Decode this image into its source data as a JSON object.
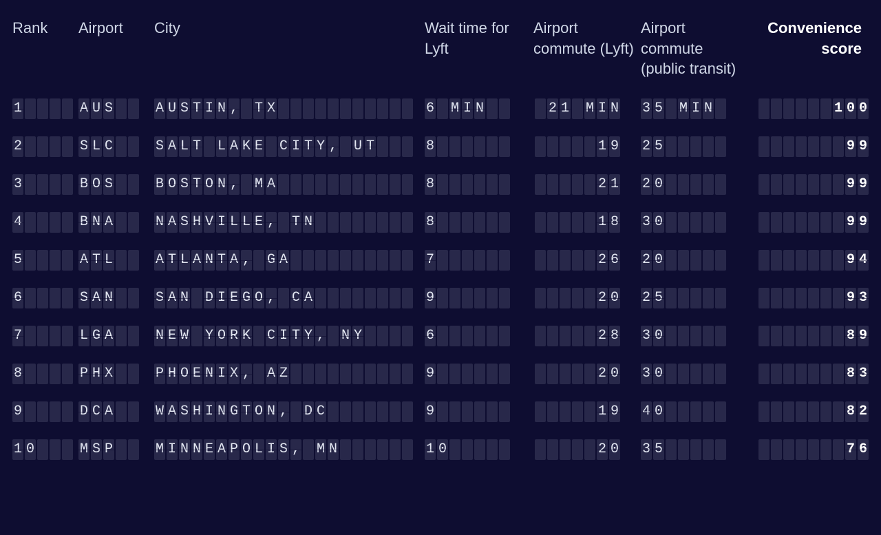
{
  "chart_data": {
    "type": "table",
    "title": "",
    "columns": [
      "Rank",
      "Airport",
      "City",
      "Wait time for Lyft",
      "Airport commute (Lyft)",
      "Airport commute (public transit)",
      "Convenience score"
    ],
    "rows": [
      {
        "rank": 1,
        "airport": "AUS",
        "city": "AUSTIN, TX",
        "wait": "6 MIN",
        "lyft": "21 MIN",
        "pt": "35 MIN",
        "score": 100
      },
      {
        "rank": 2,
        "airport": "SLC",
        "city": "SALT LAKE CITY, UT",
        "wait": "8",
        "lyft": "19",
        "pt": "25",
        "score": 99
      },
      {
        "rank": 3,
        "airport": "BOS",
        "city": "BOSTON, MA",
        "wait": "8",
        "lyft": "21",
        "pt": "20",
        "score": 99
      },
      {
        "rank": 4,
        "airport": "BNA",
        "city": "NASHVILLE, TN",
        "wait": "8",
        "lyft": "18",
        "pt": "30",
        "score": 99
      },
      {
        "rank": 5,
        "airport": "ATL",
        "city": "ATLANTA, GA",
        "wait": "7",
        "lyft": "26",
        "pt": "20",
        "score": 94
      },
      {
        "rank": 6,
        "airport": "SAN",
        "city": "SAN DIEGO, CA",
        "wait": "9",
        "lyft": "20",
        "pt": "25",
        "score": 93
      },
      {
        "rank": 7,
        "airport": "LGA",
        "city": "NEW YORK CITY, NY",
        "wait": "6",
        "lyft": "28",
        "pt": "30",
        "score": 89
      },
      {
        "rank": 8,
        "airport": "PHX",
        "city": "PHOENIX, AZ",
        "wait": "9",
        "lyft": "20",
        "pt": "30",
        "score": 83
      },
      {
        "rank": 9,
        "airport": "DCA",
        "city": "WASHINGTON, DC",
        "wait": "9",
        "lyft": "19",
        "pt": "40",
        "score": 82
      },
      {
        "rank": 10,
        "airport": "MSP",
        "city": "MINNEAPOLIS, MN",
        "wait": "10",
        "lyft": "20",
        "pt": "35",
        "score": 76
      }
    ]
  },
  "headers": {
    "rank": "Rank",
    "airport": "Airport",
    "city": "City",
    "wait": "Wait time for Lyft",
    "lyft": "Airport commute (Lyft)",
    "pt": "Airport commute (public transit)",
    "score": "Convenience score"
  },
  "layout": {
    "flap_counts": {
      "rank": 5,
      "airport": 5,
      "city": 21,
      "wait": 7,
      "lyft": 7,
      "pt": 7,
      "score": 9
    }
  },
  "colors": {
    "bg": "#0e0d31",
    "flap": "#28284a",
    "text": "#e4e8f3",
    "header_text": "#cfd6e6",
    "bold_text": "#ffffff"
  }
}
